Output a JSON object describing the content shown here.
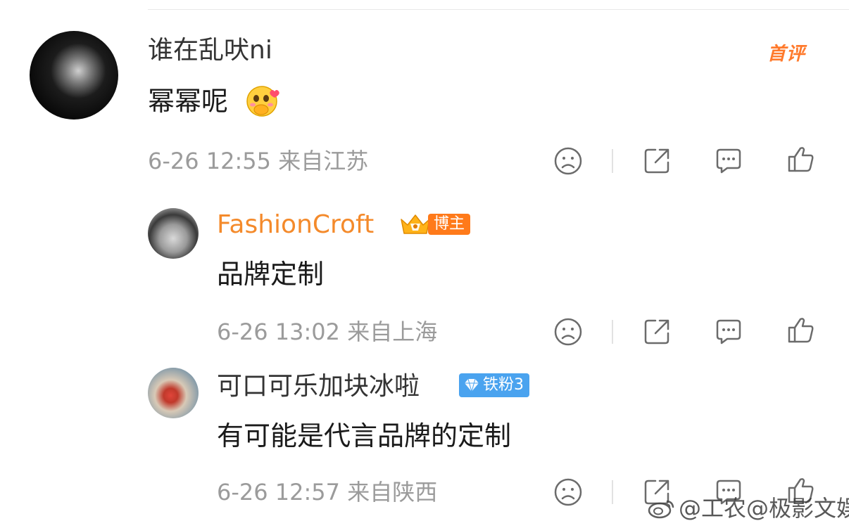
{
  "comments": [
    {
      "username": "谁在乱吠ni",
      "badge": "首评",
      "text": "幂幂呢",
      "emoji": "shy-blush-emoji",
      "meta": "6-26 12:55 来自江苏"
    },
    {
      "username": "FashionCroft",
      "badge": "博主",
      "text": "品牌定制",
      "meta": "6-26 13:02 来自上海"
    },
    {
      "username": "可口可乐加块冰啦",
      "badge": "铁粉3",
      "text": "有可能是代言品牌的定制",
      "meta": "6-26 12:57 来自陕西"
    }
  ],
  "actions": {
    "icons": [
      "dislike-icon",
      "share-icon",
      "comment-icon",
      "like-icon"
    ]
  },
  "watermark": "@工农@极影文娱",
  "colors": {
    "accent_orange": "#f48a2b",
    "badge_blue": "#4aa3ef",
    "meta_gray": "#9b9b9b"
  }
}
